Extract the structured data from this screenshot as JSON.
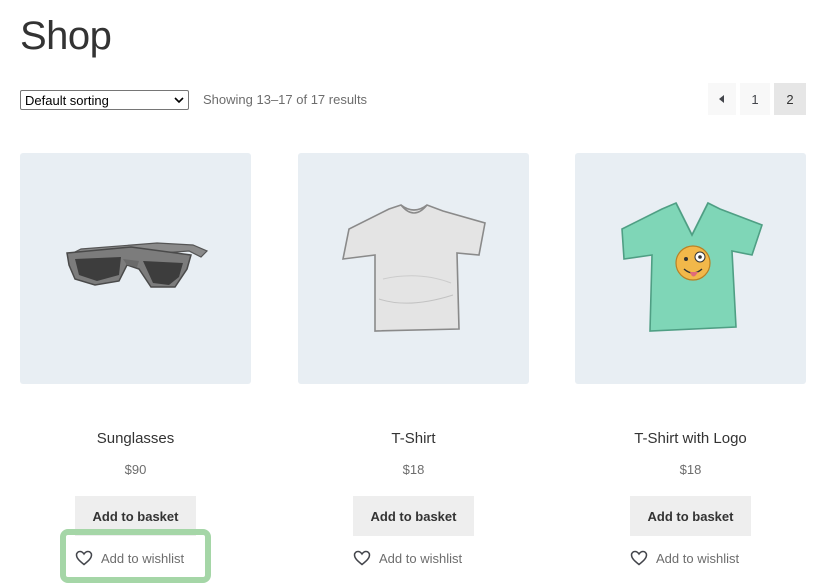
{
  "page": {
    "title": "Shop"
  },
  "toolbar": {
    "sorting": "Default sorting",
    "result_count": "Showing 13–17 of 17 results"
  },
  "pagination": {
    "prev_icon": "caret-left-icon",
    "pages": [
      "1",
      "2"
    ],
    "current": "2"
  },
  "products": [
    {
      "name": "Sunglasses",
      "price": "$90",
      "basket_label": "Add to basket",
      "wishlist_label": "Add to wishlist",
      "image": "sunglasses",
      "highlighted": true
    },
    {
      "name": "T-Shirt",
      "price": "$18",
      "basket_label": "Add to basket",
      "wishlist_label": "Add to wishlist",
      "image": "t-shirt-grey"
    },
    {
      "name": "T-Shirt with Logo",
      "price": "$18",
      "basket_label": "Add to basket",
      "wishlist_label": "Add to wishlist",
      "image": "t-shirt-green-logo"
    }
  ],
  "colors": {
    "image_bg": "#e8eef3",
    "button_bg": "#eeeeee",
    "highlight": "#a5d6a7"
  }
}
